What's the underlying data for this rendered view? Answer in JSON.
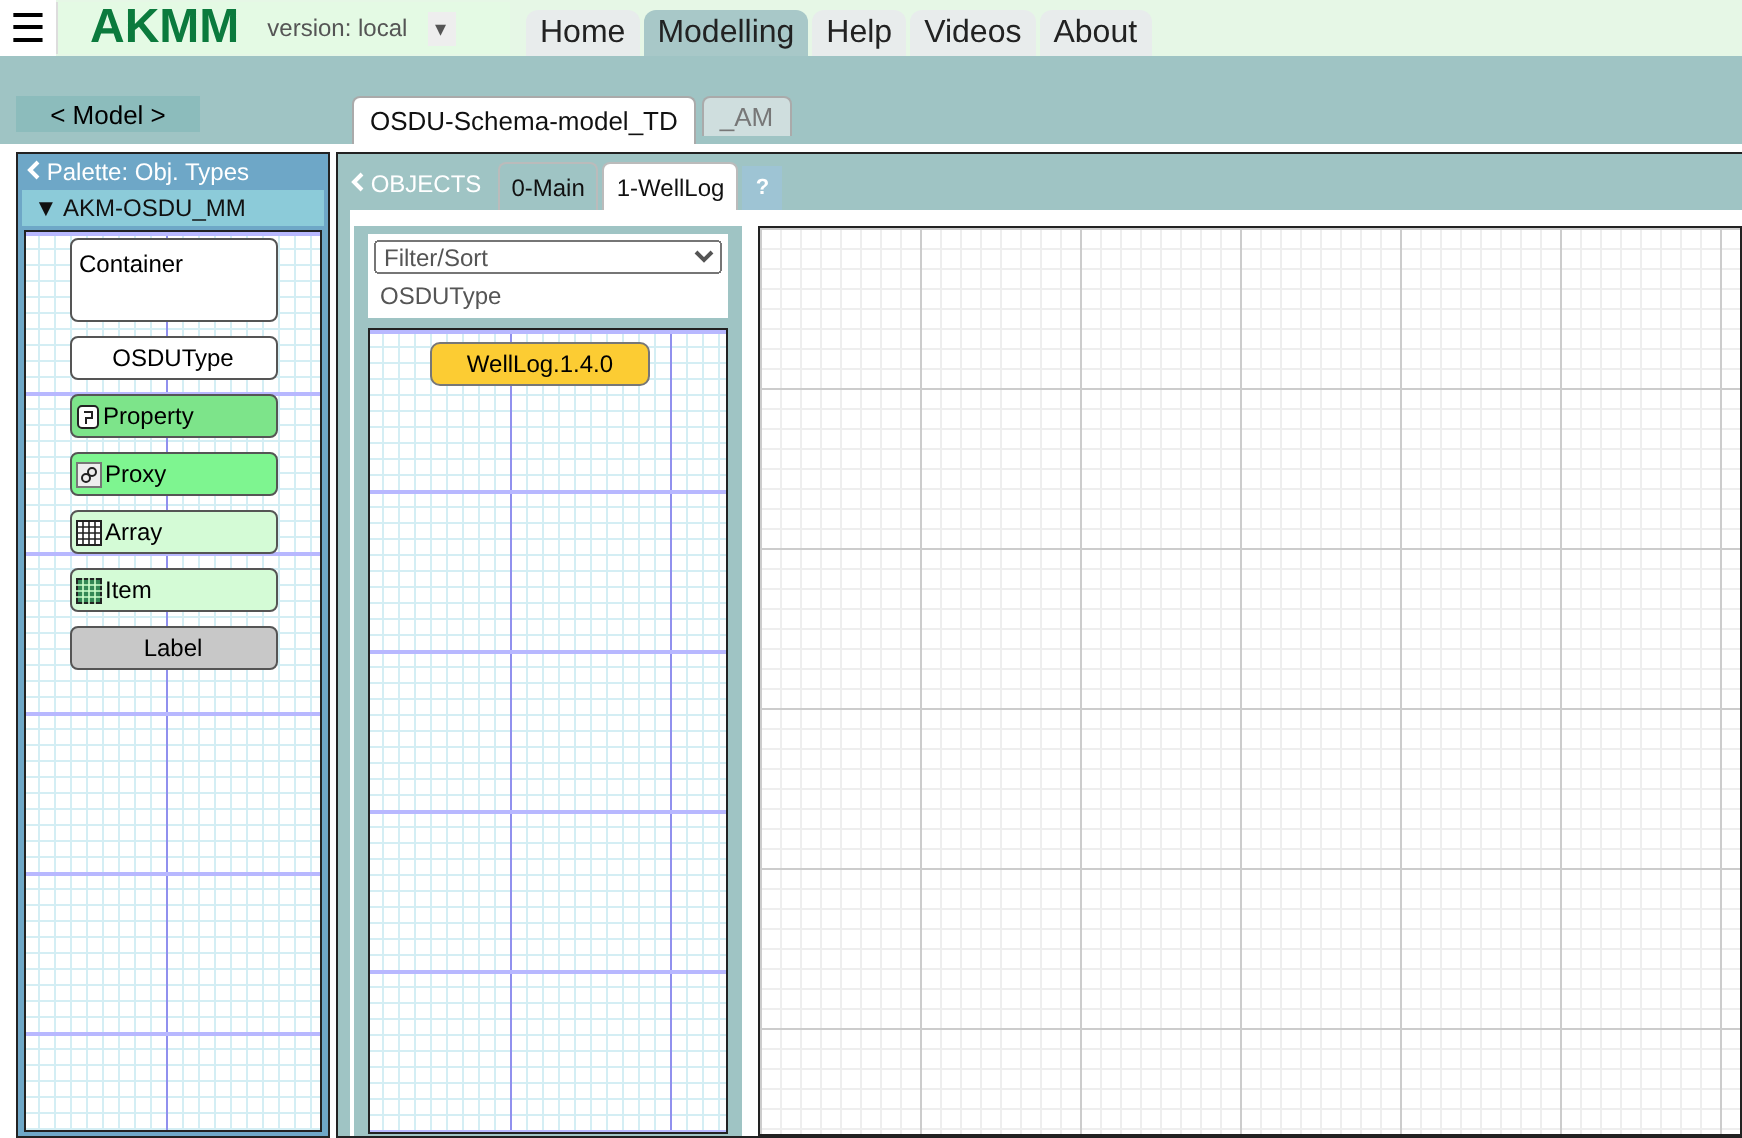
{
  "header": {
    "menu": "☰",
    "logo": "AKMM",
    "version": "version: local",
    "caret": "▾",
    "nav": [
      {
        "label": "Home",
        "selected": false
      },
      {
        "label": "Modelling",
        "selected": true
      },
      {
        "label": "Help",
        "selected": false
      },
      {
        "label": "Videos",
        "selected": false
      },
      {
        "label": "About",
        "selected": false
      }
    ]
  },
  "model_button": "< Model >",
  "model_tabs": [
    {
      "label": "OSDU-Schema-model_TD",
      "selected": true
    },
    {
      "label": "_AM",
      "selected": false
    }
  ],
  "palette": {
    "title": "Palette: Obj. Types",
    "group": "▼ AKM-OSDU_MM",
    "items": [
      {
        "kind": "container",
        "label": "Container"
      },
      {
        "kind": "type",
        "label": "OSDUType"
      },
      {
        "kind": "property",
        "label": "Property"
      },
      {
        "kind": "proxy",
        "label": "Proxy"
      },
      {
        "kind": "array",
        "label": "Array"
      },
      {
        "kind": "item",
        "label": "Item"
      },
      {
        "kind": "label",
        "label": "Label"
      }
    ]
  },
  "objects": {
    "title": "OBJECTS",
    "tabs": [
      {
        "label": "0-Main",
        "selected": false
      },
      {
        "label": "1-WellLog",
        "selected": true
      }
    ],
    "help": "?",
    "filter": {
      "placeholder": "Filter/Sort"
    },
    "filter_value": "OSDUType",
    "nodes": [
      {
        "label": "WellLog.1.4.0",
        "color": "#fccc33"
      }
    ]
  }
}
